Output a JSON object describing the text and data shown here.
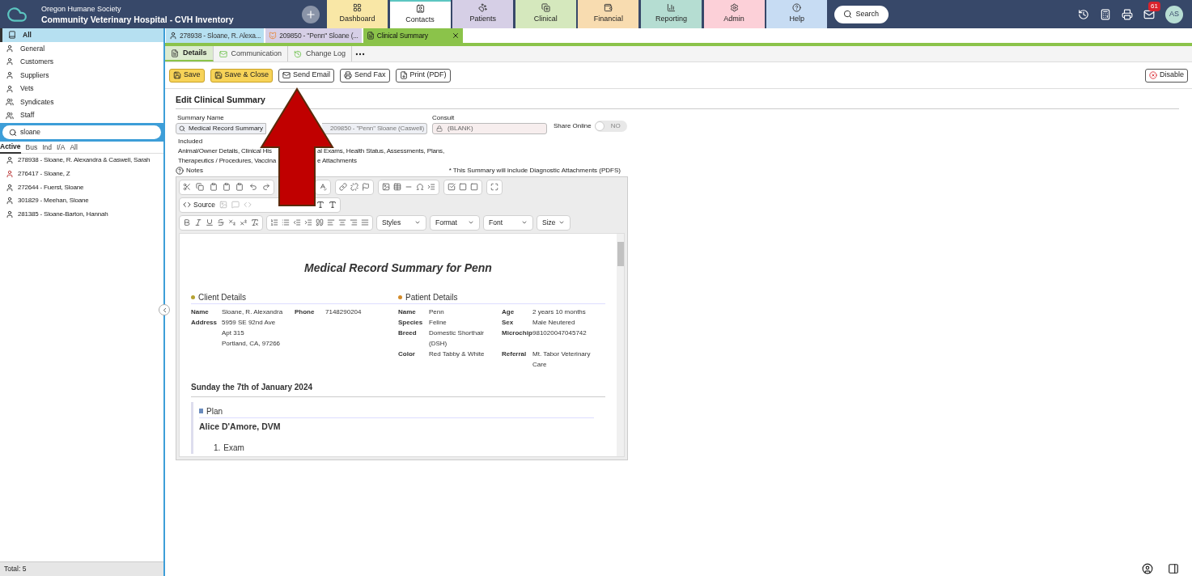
{
  "header": {
    "org": "Oregon Humane Society",
    "title": "Community Veterinary Hospital - CVH Inventory",
    "search": "Search",
    "mail_count": "61",
    "avatar": "AS"
  },
  "nav_tabs": [
    {
      "kind": "dashboard",
      "label": "Dashboard",
      "selected": false,
      "color": "#f9e7a6"
    },
    {
      "kind": "contacts",
      "label": "Contacts",
      "selected": true,
      "color": "#ffffff"
    },
    {
      "kind": "patients",
      "label": "Patients",
      "selected": false,
      "color": "#d6cfe6"
    },
    {
      "kind": "clinical",
      "label": "Clinical",
      "selected": false,
      "color": "#d5e8bd"
    },
    {
      "kind": "financial",
      "label": "Financial",
      "selected": false,
      "color": "#f8dcb0"
    },
    {
      "kind": "reporting",
      "label": "Reporting",
      "selected": false,
      "color": "#b5ddd2"
    },
    {
      "kind": "admin",
      "label": "Admin",
      "selected": false,
      "color": "#fcd0d8"
    },
    {
      "kind": "help",
      "label": "Help",
      "selected": false,
      "color": "#c7dcf3"
    }
  ],
  "sidebar": {
    "categories": [
      {
        "label": "All",
        "selected": true
      },
      {
        "label": "General",
        "selected": false
      },
      {
        "label": "Customers",
        "selected": false
      },
      {
        "label": "Suppliers",
        "selected": false
      },
      {
        "label": "Vets",
        "selected": false
      },
      {
        "label": "Syndicates",
        "selected": false
      },
      {
        "label": "Staff",
        "selected": false
      }
    ],
    "search": "sloane",
    "filters": [
      {
        "label": "Active",
        "selected": true
      },
      {
        "label": "Bus",
        "selected": false
      },
      {
        "label": "Ind",
        "selected": false
      },
      {
        "label": "I/A",
        "selected": false
      },
      {
        "label": "All",
        "selected": false
      }
    ],
    "results": [
      {
        "text": "278938 - Sloane, R. Alexandra & Caswell, Sarah",
        "flagged": false
      },
      {
        "text": "276417 - Sloane, Z",
        "flagged": true
      },
      {
        "text": "272644 - Fuerst, Sloane",
        "flagged": false
      },
      {
        "text": "301829 - Meehan, Sloane",
        "flagged": false
      },
      {
        "text": "281385 - Sloane-Barton, Hannah",
        "flagged": false
      }
    ],
    "total": "Total: 5"
  },
  "doc_tabs": [
    {
      "kind": "contact",
      "label": "278938 - Sloane, R. Alexa...",
      "selected": false
    },
    {
      "kind": "patient",
      "label": "209850 - \"Penn\" Sloane (...",
      "selected": false
    },
    {
      "kind": "summary",
      "label": "Clinical Summary",
      "selected": true
    }
  ],
  "sub_tabs": [
    {
      "kind": "details",
      "label": "Details",
      "selected": true
    },
    {
      "kind": "communication",
      "label": "Communication",
      "selected": false
    },
    {
      "kind": "changelog",
      "label": "Change Log",
      "selected": false
    }
  ],
  "actions": [
    {
      "kind": "save",
      "label": "Save",
      "primary": true
    },
    {
      "kind": "saveclose",
      "label": "Save & Close",
      "primary": true
    },
    {
      "kind": "email",
      "label": "Send Email",
      "primary": false
    },
    {
      "kind": "fax",
      "label": "Send Fax",
      "primary": false
    },
    {
      "kind": "pdf",
      "label": "Print (PDF)",
      "primary": false
    }
  ],
  "disable_button": "Disable",
  "form": {
    "heading": "Edit Clinical Summary",
    "summary_label": "Summary Name",
    "summary_value": "Medical Record Summary",
    "patient_value": "209850 - \"Penn\" Sloane (Caswell)",
    "consult_label": "Consult",
    "consult_placeholder": "(BLANK)",
    "share_label": "Share Online",
    "share_on": false,
    "share_state": "NO",
    "included_label": "Included",
    "included_lines": [
      [
        "Animal/Owner Details, Clinical His",
        "al Exams, Health Status, Assessments, Plans,"
      ],
      [
        "Therapeutics / Procedures, Vaccina",
        "e Attachments"
      ]
    ],
    "notes_label": "Notes",
    "attachments_note": "* This Summary will include Diagnostic Attachments (PDFS)"
  },
  "editor": {
    "source": "Source",
    "dropdowns": [
      "Styles",
      "Format",
      "Font",
      "Size"
    ]
  },
  "document": {
    "title": "Medical Record Summary for Penn",
    "client_heading": "Client Details",
    "patient_heading": "Patient Details",
    "client_rows": [
      [
        "Name",
        "Sloane, R. Alexandra",
        "Phone",
        "7148290204"
      ],
      [
        "Address",
        "5959 SE 92nd Ave\nApt 315\nPortland, CA, 97266"
      ]
    ],
    "patient_rows": [
      [
        "Name",
        "Penn",
        "Age",
        "2 years 10 months"
      ],
      [
        "Species",
        "Feline",
        "Sex",
        "Male Neutered"
      ],
      [
        "Breed",
        "Domestic Shorthair (DSH)",
        "Microchip",
        "981020047045742"
      ],
      [
        "Color",
        "Red Tabby & White",
        "Referral",
        "Mt. Tabor Veterinary Care"
      ]
    ],
    "date": "Sunday the 7th of January 2024",
    "plan": "Plan",
    "vet": "Alice D'Amore, DVM",
    "items": [
      {
        "number": "1.",
        "text": "Exam"
      }
    ]
  }
}
